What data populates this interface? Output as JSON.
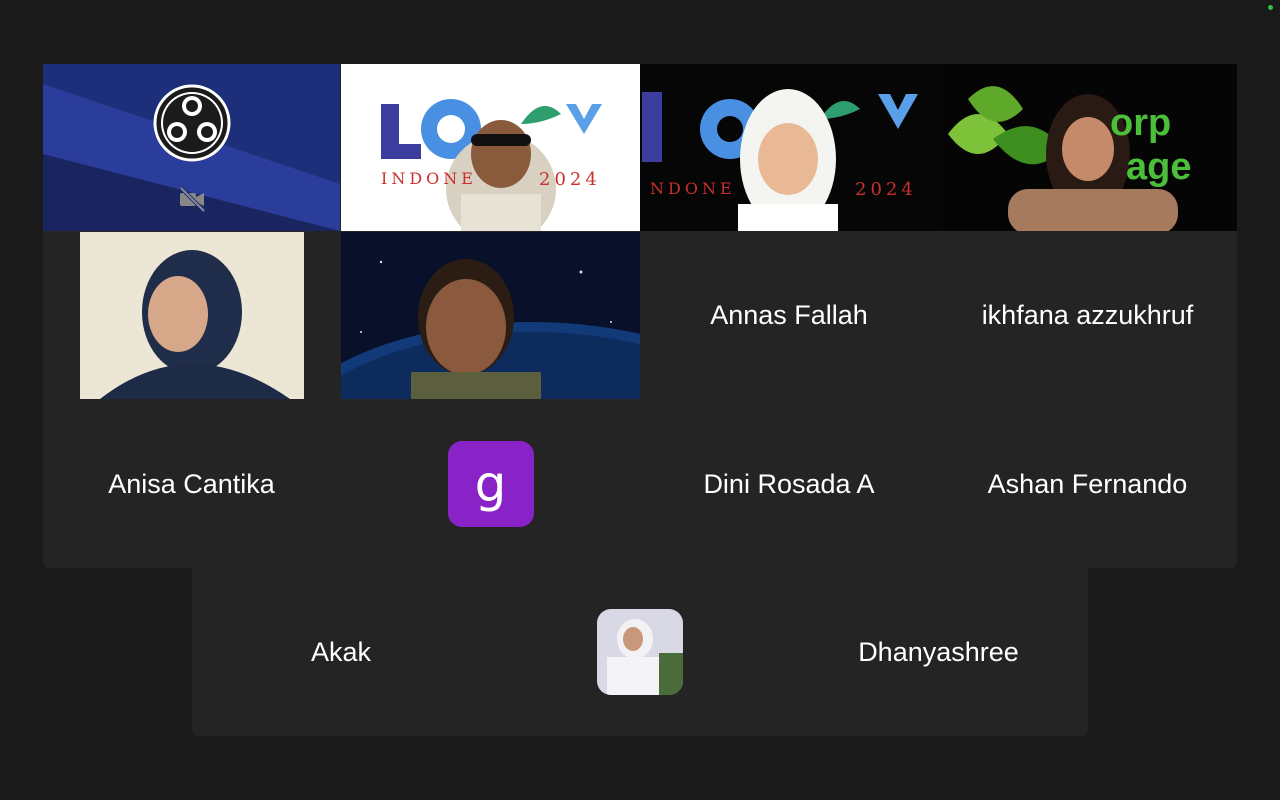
{
  "participants": {
    "row3": {
      "akak": {
        "name": "Akak"
      },
      "dhanyashree": {
        "name": "Dhanyashree"
      }
    },
    "row2": {
      "anisa_cantika": {
        "name": "Anisa Cantika"
      },
      "g_user": {
        "initial": "g"
      },
      "dini_rosada": {
        "name": "Dini Rosada A"
      },
      "ashan_fernando": {
        "name": "Ashan Fernando"
      }
    },
    "row1": {
      "annas_fallah": {
        "name": "Annas Fallah"
      },
      "ikhfana": {
        "name": "ikhfana azzukhruf"
      }
    }
  },
  "banners": {
    "loopy_year": "2024",
    "loopy_country_fragment": "INDONE",
    "loopy_country_fragment2": "NDONE",
    "corp_word1": "orp",
    "corp_word2": "age"
  },
  "colors": {
    "active_speaker": "#2fd15a",
    "avatar_purple": "#8a23c7",
    "tile_bg": "#242424",
    "window_bg": "#1a1a1a"
  }
}
